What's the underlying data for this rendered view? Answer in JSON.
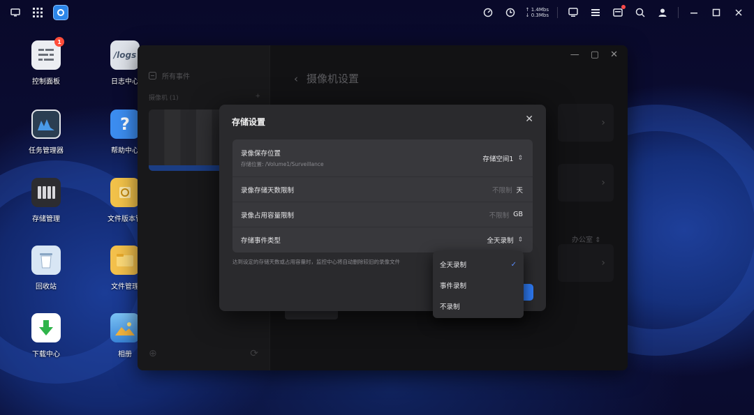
{
  "taskbar": {
    "net_up": "↑ 1.4Mbs",
    "net_down": "↓ 0.3Mbs"
  },
  "desktop": {
    "icons_col1": [
      {
        "label": "控制面板",
        "icon": "control-panel-icon",
        "badge": "1"
      },
      {
        "label": "任务管理器",
        "icon": "task-manager-icon"
      },
      {
        "label": "存储管理",
        "icon": "storage-manager-icon"
      },
      {
        "label": "回收站",
        "icon": "recycle-bin-icon"
      },
      {
        "label": "下载中心",
        "icon": "download-center-icon"
      }
    ],
    "icons_col2": [
      {
        "label": "日志中心",
        "icon": "log-center-icon",
        "glyph": "/logs"
      },
      {
        "label": "帮助中心",
        "icon": "help-center-icon",
        "glyph": "?"
      },
      {
        "label": "文件版本管",
        "icon": "file-version-icon"
      },
      {
        "label": "文件管理",
        "icon": "file-manager-icon"
      },
      {
        "label": "相册",
        "icon": "photos-icon"
      }
    ]
  },
  "window": {
    "back_title": "摄像机设置",
    "sidebar_header": "所有事件",
    "sidebar_group": "摄像机 (1)",
    "sidebar_add": "+",
    "office_value": "办公室"
  },
  "dialog": {
    "title": "存储设置",
    "rows": [
      {
        "label": "录像保存位置",
        "sub": "存储位置: /Volume1/Surveillance",
        "value": "存储空间1"
      },
      {
        "label": "录像存储天数限制",
        "placeholder": "不限制",
        "unit": "天"
      },
      {
        "label": "录像占用容量限制",
        "placeholder": "不限制",
        "unit": "GB"
      },
      {
        "label": "存储事件类型",
        "value": "全天录制"
      }
    ],
    "note": "达到设定的存储天数或占用容量时，监控中心将自动删除较旧的录像文件"
  },
  "dropdown": {
    "options": [
      {
        "label": "全天录制",
        "selected": true
      },
      {
        "label": "事件录制",
        "selected": false
      },
      {
        "label": "不录制",
        "selected": false
      }
    ]
  },
  "colors": {
    "accent": "#2f7cf6",
    "check": "#5a8dff"
  }
}
